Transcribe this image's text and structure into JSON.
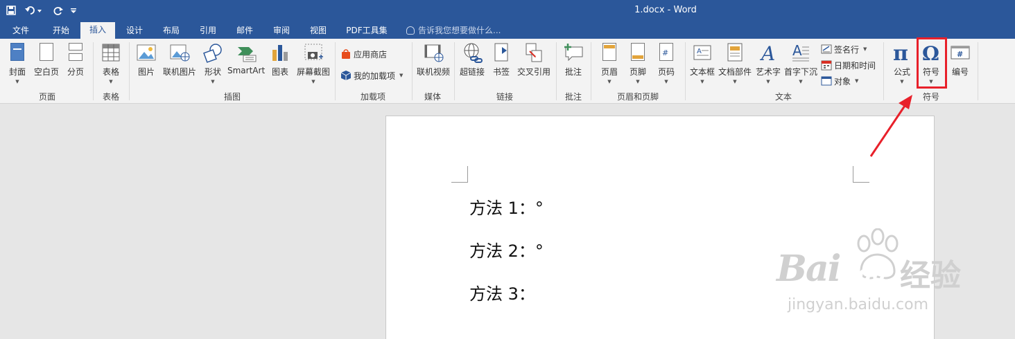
{
  "window": {
    "title": "1.docx - Word"
  },
  "quick_access": {
    "save_icon": "save-icon",
    "undo_icon": "undo-icon",
    "redo_icon": "redo-icon",
    "customize_icon": "customize-icon"
  },
  "tabs": [
    {
      "label": "文件"
    },
    {
      "label": "开始"
    },
    {
      "label": "插入"
    },
    {
      "label": "设计"
    },
    {
      "label": "布局"
    },
    {
      "label": "引用"
    },
    {
      "label": "邮件"
    },
    {
      "label": "审阅"
    },
    {
      "label": "视图"
    },
    {
      "label": "PDF工具集"
    }
  ],
  "active_tab": "插入",
  "tell_me": "告诉我您想要做什么...",
  "ribbon": {
    "pages": {
      "cover": "封面",
      "blank": "空白页",
      "break": "分页",
      "group": "页面"
    },
    "tables": {
      "table": "表格",
      "group": "表格"
    },
    "illustrations": {
      "picture": "图片",
      "online_picture": "联机图片",
      "shapes": "形状",
      "smartart": "SmartArt",
      "chart": "图表",
      "screenshot": "屏幕截图",
      "group": "插图"
    },
    "addins": {
      "store": "应用商店",
      "my_addins": "我的加载项",
      "group": "加载项"
    },
    "media": {
      "online_video": "联机视频",
      "group": "媒体"
    },
    "links": {
      "hyperlink": "超链接",
      "bookmark": "书签",
      "cross_ref": "交叉引用",
      "group": "链接"
    },
    "comments": {
      "comment": "批注",
      "group": "批注"
    },
    "header_footer": {
      "header": "页眉",
      "footer": "页脚",
      "page_number": "页码",
      "group": "页眉和页脚"
    },
    "text": {
      "textbox": "文本框",
      "quick_parts": "文档部件",
      "wordart": "艺术字",
      "dropcap": "首字下沉",
      "signature": "签名行",
      "datetime": "日期和时间",
      "object": "对象",
      "group": "文本"
    },
    "symbols": {
      "equation": "公式",
      "symbol": "符号",
      "numbering": "编号",
      "group": "符号"
    }
  },
  "document": {
    "lines": [
      "方法 1：°",
      "方法 2：°",
      "方法 3："
    ]
  },
  "watermark": {
    "brand": "Bai",
    "brand2": "du",
    "cn": "经验",
    "url": "jingyan.baidu.com"
  },
  "colors": {
    "accent": "#2b579a",
    "highlight": "#e8202a"
  }
}
